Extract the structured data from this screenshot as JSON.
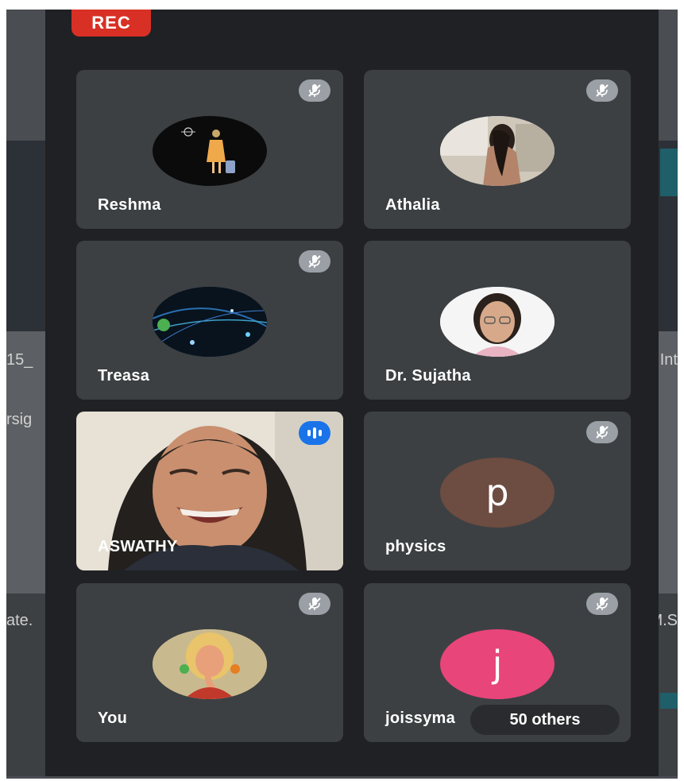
{
  "recording": {
    "label": "REC"
  },
  "background_fragments": [
    "15_",
    "rsig",
    "ate.",
    "Int",
    "M.S"
  ],
  "participants": [
    {
      "name": "Reshma",
      "muted": true
    },
    {
      "name": "Athalia",
      "muted": true
    },
    {
      "name": "Treasa",
      "muted": true
    },
    {
      "name": "Dr. Sujatha",
      "muted": false
    },
    {
      "name": "ASWATHY",
      "muted": false,
      "speaking": true
    },
    {
      "name": "physics",
      "muted": true,
      "initial": "p",
      "avatar_color": "#6d4c41"
    },
    {
      "name": "You",
      "muted": true
    },
    {
      "name": "joissyma",
      "muted": true,
      "initial": "j",
      "avatar_color": "#e8457a"
    }
  ],
  "others": {
    "label": "50 others"
  },
  "colors": {
    "panel": "#202124",
    "tile": "#3c4043",
    "rec": "#d93025",
    "speaking": "#1a73e8"
  }
}
